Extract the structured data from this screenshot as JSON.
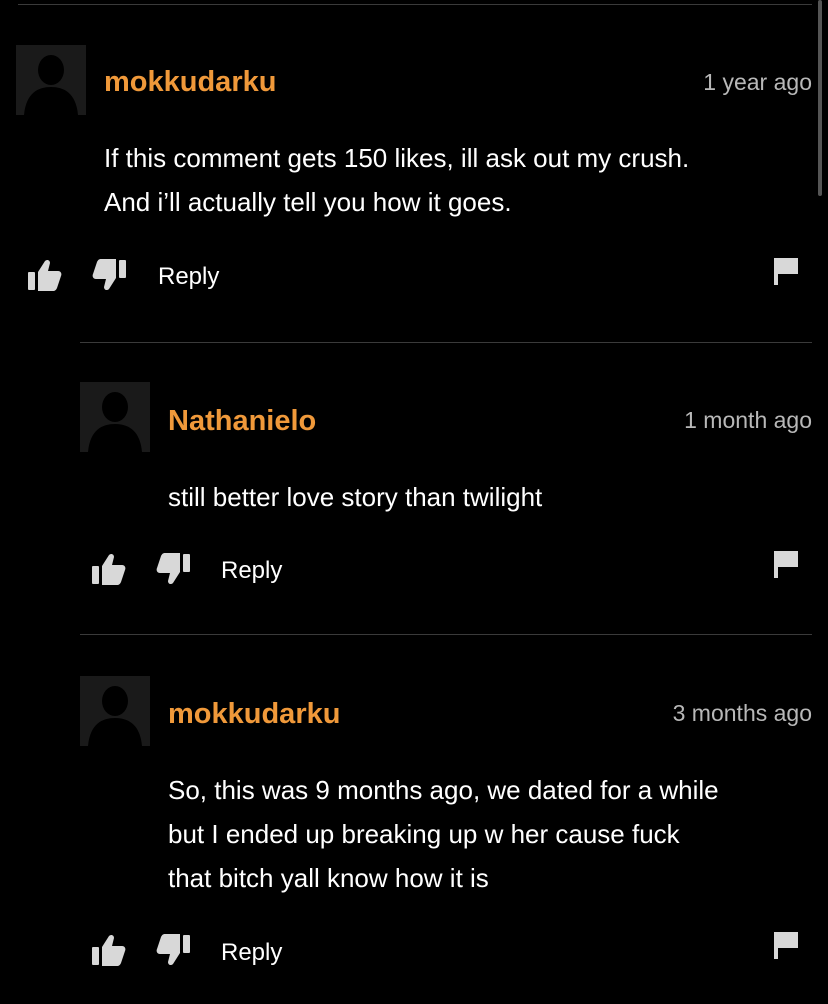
{
  "comments": [
    {
      "username": "mokkudarku",
      "timestamp": "1 year ago",
      "lines": [
        "If this comment gets 150 likes, ill ask out my crush.",
        "And i’ll actually tell you how it goes."
      ],
      "reply_label": "Reply",
      "avatar_icon": "default-user-avatar",
      "like_icon": "thumbs-up-icon",
      "dislike_icon": "thumbs-down-icon",
      "flag_icon": "flag-icon"
    },
    {
      "username": "Nathanielo",
      "timestamp": "1 month ago",
      "lines": [
        "still better love story than twilight"
      ],
      "reply_label": "Reply",
      "avatar_icon": "default-user-avatar",
      "like_icon": "thumbs-up-icon",
      "dislike_icon": "thumbs-down-icon",
      "flag_icon": "flag-icon"
    },
    {
      "username": "mokkudarku",
      "timestamp": "3 months ago",
      "lines": [
        "So, this was 9 months ago, we dated for a while",
        "but I ended up breaking up w her cause fuck",
        "that bitch yall know how it is"
      ],
      "reply_label": "Reply",
      "avatar_icon": "default-user-avatar",
      "like_icon": "thumbs-up-icon",
      "dislike_icon": "thumbs-down-icon",
      "flag_icon": "flag-icon"
    }
  ],
  "colors": {
    "background": "#000000",
    "username": "#f0993a",
    "timestamp": "#b8b8b8",
    "text": "#ffffff",
    "icon": "#d8d8d8",
    "divider": "#3a3a3a"
  }
}
